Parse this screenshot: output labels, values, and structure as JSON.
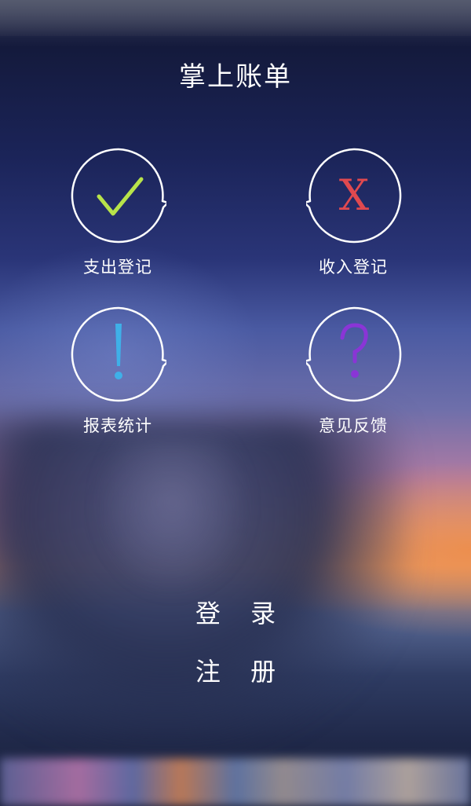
{
  "app": {
    "title": "掌上账单"
  },
  "menu": [
    {
      "label": "支出登记",
      "icon": "check-icon",
      "color": "#b8e34a"
    },
    {
      "label": "收入登记",
      "icon": "x-icon",
      "color": "#e0494f"
    },
    {
      "label": "报表统计",
      "icon": "exclamation-icon",
      "color": "#3fb0e8"
    },
    {
      "label": "意见反馈",
      "icon": "question-icon",
      "color": "#8a35d6"
    }
  ],
  "actions": {
    "login_label": "登 录",
    "register_label": "注 册"
  }
}
